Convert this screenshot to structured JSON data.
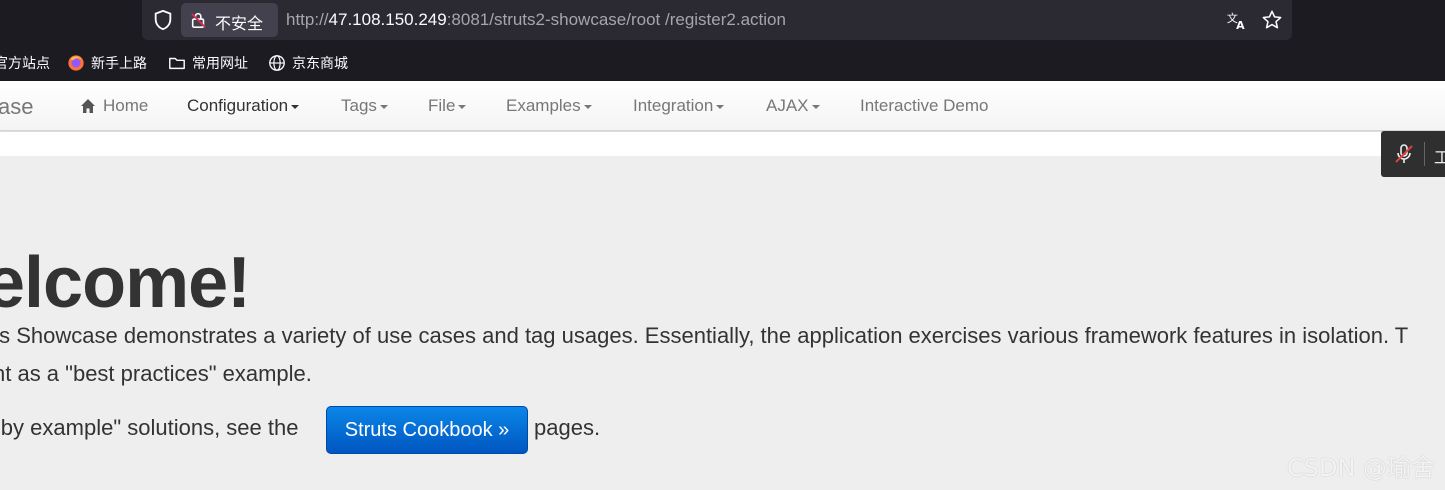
{
  "browser": {
    "security_label": "不安全",
    "url_scheme": "http://",
    "url_host": "47.108.150.249",
    "url_rest": ":8081/struts2-showcase/root /register2.action",
    "bookmarks": [
      {
        "label": "官方站点",
        "icon": "partial"
      },
      {
        "label": "新手上路",
        "icon": "firefox-icon"
      },
      {
        "label": "常用网址",
        "icon": "folder-icon"
      },
      {
        "label": "京东商城",
        "icon": "globe-icon"
      }
    ]
  },
  "navbar": {
    "brand": "ase",
    "items": [
      {
        "label": "Home"
      },
      {
        "label": "Configuration"
      },
      {
        "label": "Tags"
      },
      {
        "label": "File"
      },
      {
        "label": "Examples"
      },
      {
        "label": "Integration"
      },
      {
        "label": "AJAX"
      },
      {
        "label": "Interactive Demo"
      }
    ]
  },
  "floating_tool": {
    "text": "工"
  },
  "jumbotron": {
    "heading": "elcome!",
    "line1": "ts Showcase demonstrates a variety of use cases and tag usages. Essentially, the application exercises various framework features in isolation. T",
    "line2": "nt as a \"best practices\" example.",
    "line3_prefix": "\"by example\" solutions, see the",
    "cookbook_button": "Struts Cookbook »",
    "line3_suffix": "pages."
  },
  "watermark": "CSDN @瑜舍",
  "colors": {
    "primary_button": "#0068d6",
    "chrome_bg": "#1c1b22",
    "page_bg": "#eeeeee"
  }
}
